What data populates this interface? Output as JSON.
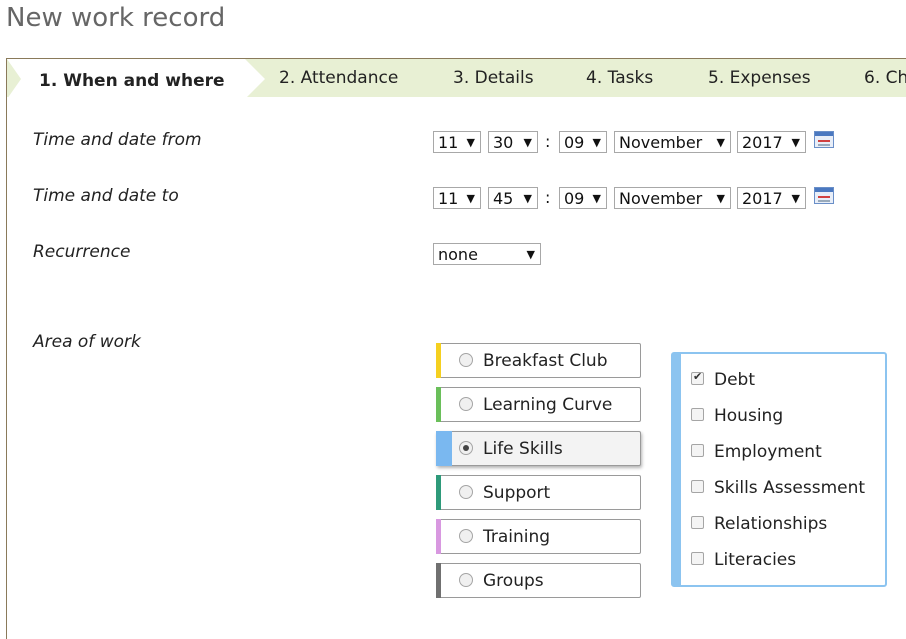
{
  "page": {
    "title": "New work record"
  },
  "tabs": [
    {
      "label": "1. When and where",
      "active": true
    },
    {
      "label": "2. Attendance"
    },
    {
      "label": "3. Details"
    },
    {
      "label": "4. Tasks"
    },
    {
      "label": "5. Expenses"
    },
    {
      "label": "6. Ch"
    }
  ],
  "time_from": {
    "label": "Time and date from",
    "hour": "11",
    "minute": "30",
    "separator": ":",
    "day": "09",
    "month": "November",
    "year": "2017",
    "calendar_icon": "calendar-icon"
  },
  "time_to": {
    "label": "Time and date to",
    "hour": "11",
    "minute": "45",
    "separator": ":",
    "day": "09",
    "month": "November",
    "year": "2017",
    "calendar_icon": "calendar-icon"
  },
  "recurrence": {
    "label": "Recurrence",
    "value": "none"
  },
  "area_of_work": {
    "label": "Area of work",
    "options": [
      {
        "label": "Breakfast Club",
        "color": "#f5d020",
        "selected": false
      },
      {
        "label": "Learning Curve",
        "color": "#6abf5a",
        "selected": false
      },
      {
        "label": "Life Skills",
        "color": "#7ab8f0",
        "selected": true
      },
      {
        "label": "Support",
        "color": "#2e9a7a",
        "selected": false
      },
      {
        "label": "Training",
        "color": "#d898e0",
        "selected": false
      },
      {
        "label": "Groups",
        "color": "#707070",
        "selected": false
      }
    ],
    "subareas": [
      {
        "label": "Debt",
        "checked": true
      },
      {
        "label": "Housing",
        "checked": false
      },
      {
        "label": "Employment",
        "checked": false
      },
      {
        "label": "Skills Assessment",
        "checked": false
      },
      {
        "label": "Relationships",
        "checked": false
      },
      {
        "label": "Literacies",
        "checked": false
      }
    ]
  },
  "colors": {
    "tab_bar": "#e8f0d4",
    "subpanel_accent": "#8cc4f0",
    "title_text": "#666666"
  }
}
